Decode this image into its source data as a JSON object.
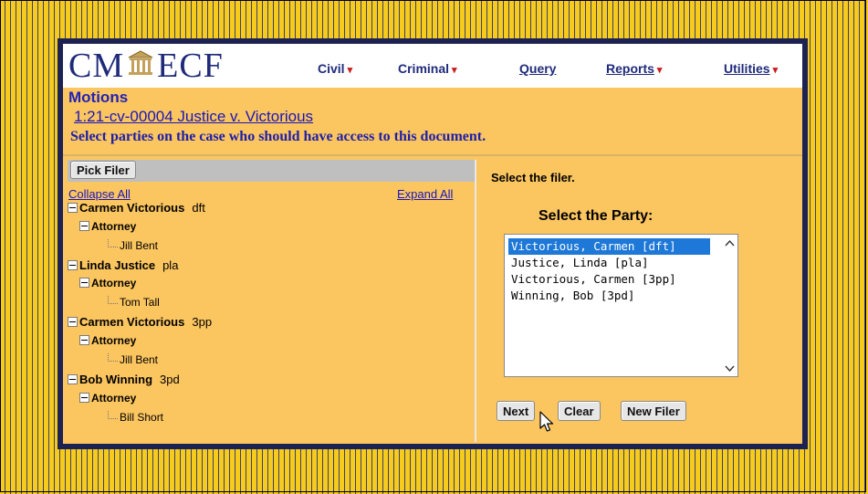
{
  "logo": {
    "left": "CM",
    "right": "ECF"
  },
  "nav": [
    {
      "label": "Civil"
    },
    {
      "label": "Criminal"
    },
    {
      "label": "Query"
    },
    {
      "label": "Reports"
    },
    {
      "label": "Utilities"
    }
  ],
  "page": {
    "title": "Motions",
    "case_link": "1:21-cv-00004 Justice v. Victorious",
    "instruction": "Select parties on the case who should have access to this document."
  },
  "tree_panel": {
    "pick_filer": "Pick Filer",
    "collapse_all": "Collapse All",
    "expand_all": "Expand All",
    "parties": [
      {
        "name": "Carmen Victorious",
        "role": "dft",
        "group": "Attorney",
        "attorney": "Jill Bent"
      },
      {
        "name": "Linda Justice",
        "role": "pla",
        "group": "Attorney",
        "attorney": "Tom Tall"
      },
      {
        "name": "Carmen Victorious",
        "role": "3pp",
        "group": "Attorney",
        "attorney": "Jill Bent"
      },
      {
        "name": "Bob Winning",
        "role": "3pd",
        "group": "Attorney",
        "attorney": "Bill Short"
      }
    ]
  },
  "select_panel": {
    "instruction": "Select the filer.",
    "heading": "Select the Party:",
    "options": [
      {
        "label": "Victorious, Carmen [dft]",
        "selected": true
      },
      {
        "label": "Justice, Linda [pla]",
        "selected": false
      },
      {
        "label": "Victorious, Carmen [3pp]",
        "selected": false
      },
      {
        "label": "Winning, Bob [3pd]",
        "selected": false
      }
    ],
    "buttons": {
      "next": "Next",
      "clear": "Clear",
      "new_filer": "New Filer"
    }
  },
  "colors": {
    "background_stripe": "#f7cb1c",
    "panel": "#fbc560",
    "frame": "#1c2353",
    "brand_blue": "#1f2a7a",
    "selection": "#1e78d7"
  }
}
